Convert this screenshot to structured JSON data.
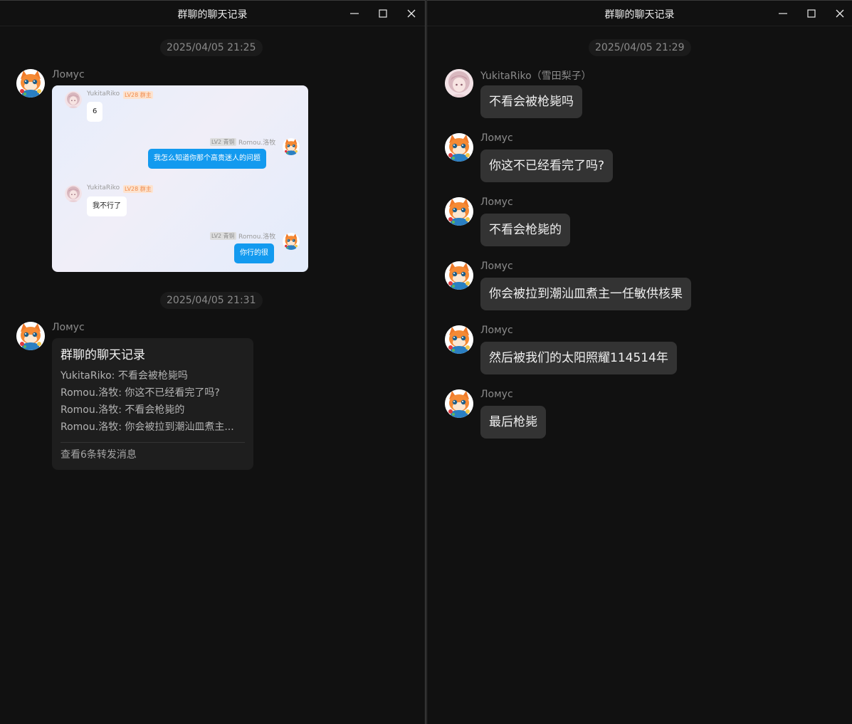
{
  "colors": {
    "background": "#111111",
    "bubble": "#333333",
    "accent_blue": "#139aef",
    "owner_tag": "#f08a4b"
  },
  "left_window": {
    "title": "群聊的聊天记录",
    "controls": {
      "minimize": "minimize-icon",
      "maximize": "maximize-icon",
      "close": "close-icon"
    },
    "timestamp_1": "2025/04/05 21:25",
    "msg1": {
      "sender": "Ломус",
      "screenshot": {
        "m1": {
          "name": "YukitaRiko",
          "tag": "LV28 群主",
          "text": "6"
        },
        "m2": {
          "name": "Romou.洛牧",
          "tag": "LV2 青铜",
          "text": "我怎么知道你那个高贵迷人的问题"
        },
        "m3": {
          "name": "YukitaRiko",
          "tag": "LV28 群主",
          "text": "我不行了"
        },
        "m4": {
          "name": "Romou.洛牧",
          "tag": "LV2 青铜",
          "text": "你行的很"
        }
      }
    },
    "timestamp_2": "2025/04/05 21:31",
    "msg2": {
      "sender": "Ломус",
      "forward": {
        "title": "群聊的聊天记录",
        "lines": [
          "YukitaRiko: 不看会被枪毙吗",
          "Romou.洛牧: 你这不已经看完了吗?",
          "Romou.洛牧: 不看会枪毙的",
          "Romou.洛牧: 你会被拉到潮汕皿煮主..."
        ],
        "footer": "查看6条转发消息"
      }
    }
  },
  "right_window": {
    "title": "群聊的聊天记录",
    "controls": {
      "minimize": "minimize-icon",
      "maximize": "maximize-icon",
      "close": "close-icon"
    },
    "timestamp": "2025/04/05 21:29",
    "messages": [
      {
        "sender": "YukitaRiko（雪田梨子）",
        "text": "不看会被枪毙吗"
      },
      {
        "sender": "Ломус",
        "text": "你这不已经看完了吗?"
      },
      {
        "sender": "Ломус",
        "text": "不看会枪毙的"
      },
      {
        "sender": "Ломус",
        "text": "你会被拉到潮汕皿煮主一任敏供核果"
      },
      {
        "sender": "Ломус",
        "text": "然后被我们的太阳照耀114514年"
      },
      {
        "sender": "Ломус",
        "text": "最后枪毙"
      }
    ]
  }
}
